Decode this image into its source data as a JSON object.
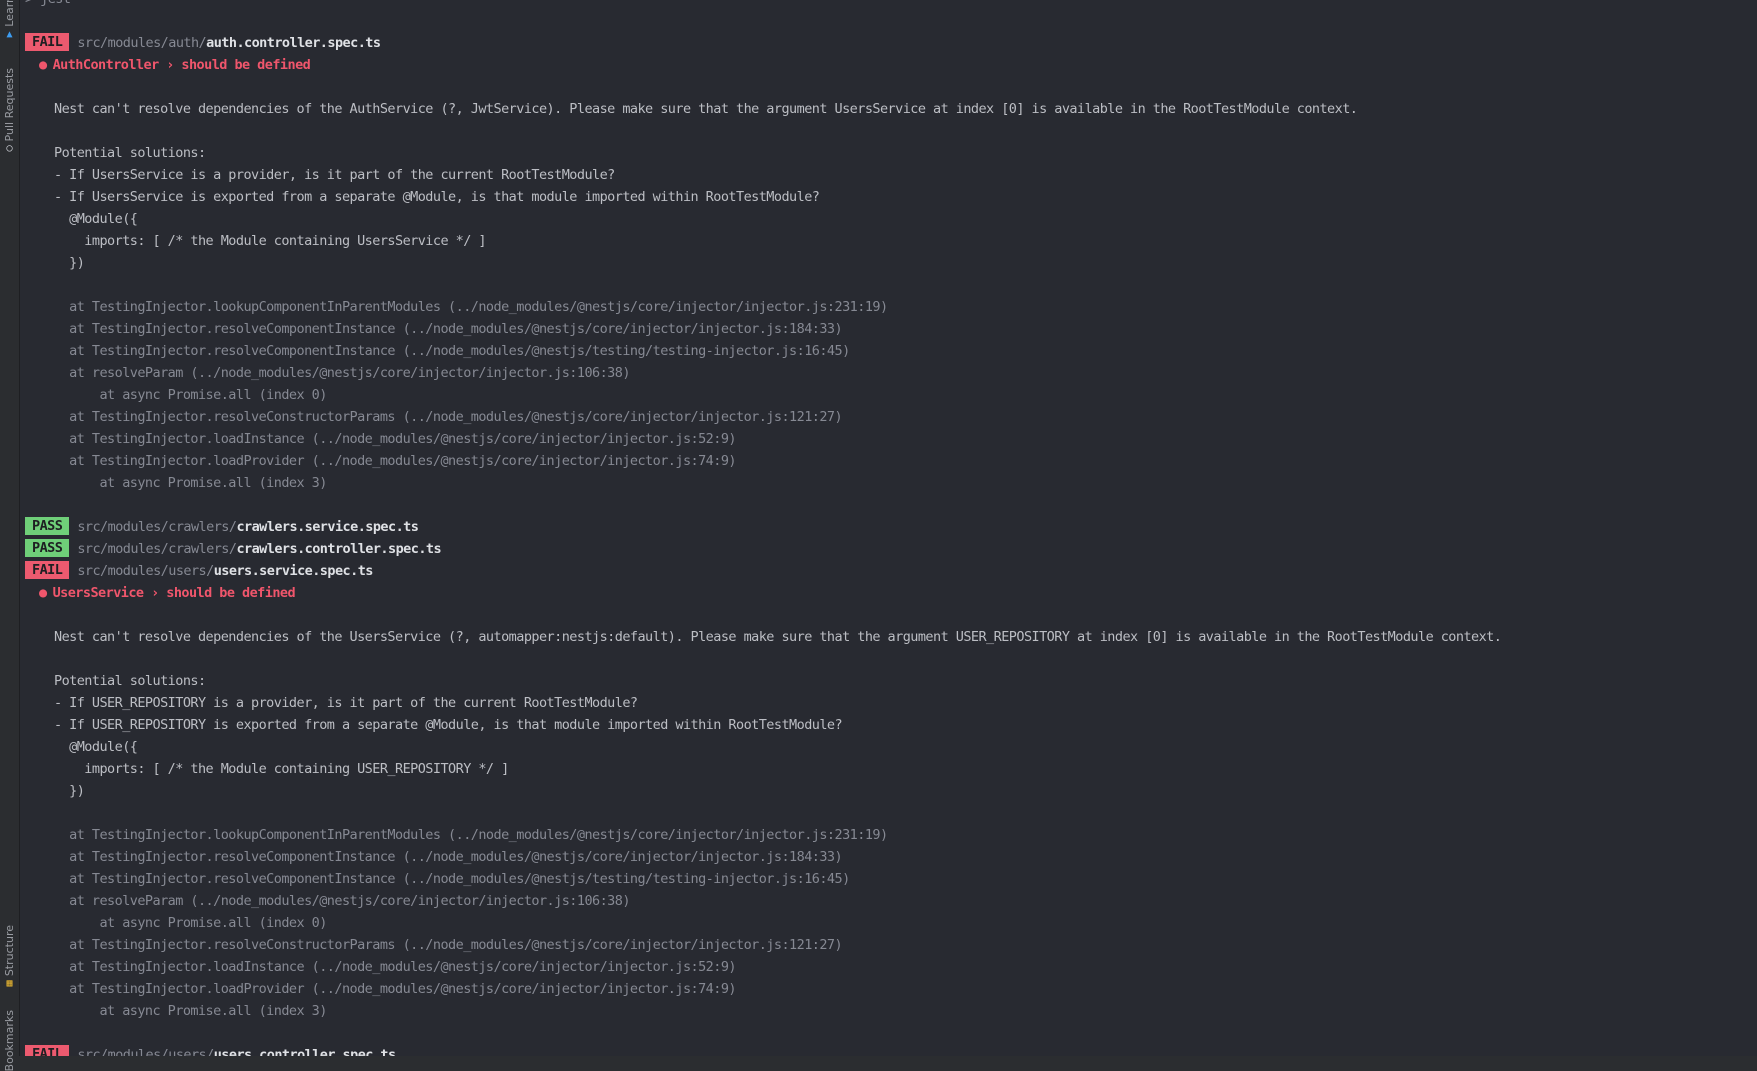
{
  "sidebar": {
    "top_items": [
      {
        "label": "Learn",
        "icon": "graduation-cap-icon"
      },
      {
        "label": "Pull Requests",
        "icon": "github-icon"
      }
    ],
    "bottom_items": [
      {
        "label": "Structure",
        "icon": "structure-icon"
      },
      {
        "label": "Bookmarks",
        "icon": "bookmark-icon"
      }
    ]
  },
  "terminal": {
    "command": "> jest",
    "colors": {
      "fail": "#ec5a6f",
      "pass": "#6fcf79",
      "error": "#f0566c"
    },
    "suites": [
      {
        "status": "FAIL",
        "dir": "src/modules/auth/",
        "file": "auth.controller.spec.ts",
        "test": "AuthController › should be defined",
        "message": "Nest can't resolve dependencies of the AuthService (?, JwtService). Please make sure that the argument UsersService at index [0] is available in the RootTestModule context.",
        "solutions_header": "Potential solutions:",
        "solutions": [
          "- If UsersService is a provider, is it part of the current RootTestModule?",
          "- If UsersService is exported from a separate @Module, is that module imported within RootTestModule?",
          "  @Module({",
          "    imports: [ /* the Module containing UsersService */ ]",
          "  })"
        ],
        "stack": [
          "  at TestingInjector.lookupComponentInParentModules (../node_modules/@nestjs/core/injector/injector.js:231:19)",
          "  at TestingInjector.resolveComponentInstance (../node_modules/@nestjs/core/injector/injector.js:184:33)",
          "  at TestingInjector.resolveComponentInstance (../node_modules/@nestjs/testing/testing-injector.js:16:45)",
          "  at resolveParam (../node_modules/@nestjs/core/injector/injector.js:106:38)",
          "      at async Promise.all (index 0)",
          "  at TestingInjector.resolveConstructorParams (../node_modules/@nestjs/core/injector/injector.js:121:27)",
          "  at TestingInjector.loadInstance (../node_modules/@nestjs/core/injector/injector.js:52:9)",
          "  at TestingInjector.loadProvider (../node_modules/@nestjs/core/injector/injector.js:74:9)",
          "      at async Promise.all (index 3)"
        ]
      },
      {
        "status": "PASS",
        "dir": "src/modules/crawlers/",
        "file": "crawlers.service.spec.ts"
      },
      {
        "status": "PASS",
        "dir": "src/modules/crawlers/",
        "file": "crawlers.controller.spec.ts"
      },
      {
        "status": "FAIL",
        "dir": "src/modules/users/",
        "file": "users.service.spec.ts",
        "test": "UsersService › should be defined",
        "message": "Nest can't resolve dependencies of the UsersService (?, automapper:nestjs:default). Please make sure that the argument USER_REPOSITORY at index [0] is available in the RootTestModule context.",
        "solutions_header": "Potential solutions:",
        "solutions": [
          "- If USER_REPOSITORY is a provider, is it part of the current RootTestModule?",
          "- If USER_REPOSITORY is exported from a separate @Module, is that module imported within RootTestModule?",
          "  @Module({",
          "    imports: [ /* the Module containing USER_REPOSITORY */ ]",
          "  })"
        ],
        "stack": [
          "  at TestingInjector.lookupComponentInParentModules (../node_modules/@nestjs/core/injector/injector.js:231:19)",
          "  at TestingInjector.resolveComponentInstance (../node_modules/@nestjs/core/injector/injector.js:184:33)",
          "  at TestingInjector.resolveComponentInstance (../node_modules/@nestjs/testing/testing-injector.js:16:45)",
          "  at resolveParam (../node_modules/@nestjs/core/injector/injector.js:106:38)",
          "      at async Promise.all (index 0)",
          "  at TestingInjector.resolveConstructorParams (../node_modules/@nestjs/core/injector/injector.js:121:27)",
          "  at TestingInjector.loadInstance (../node_modules/@nestjs/core/injector/injector.js:52:9)",
          "  at TestingInjector.loadProvider (../node_modules/@nestjs/core/injector/injector.js:74:9)",
          "      at async Promise.all (index 3)"
        ]
      },
      {
        "status": "FAIL",
        "dir": "src/modules/users/",
        "file": "users.controller.spec.ts"
      }
    ]
  }
}
